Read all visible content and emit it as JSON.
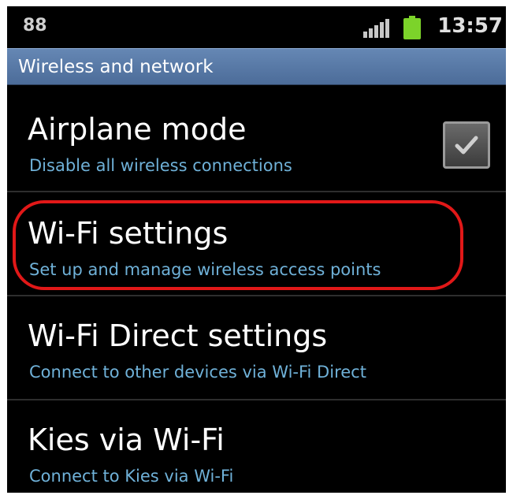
{
  "status_bar": {
    "left_indicator": "88",
    "time": "13:57",
    "signal_icon": "signal-bars-icon",
    "battery_icon": "battery-icon",
    "battery_color": "#7cd32a"
  },
  "section": {
    "title": "Wireless and network"
  },
  "items": [
    {
      "title": "Airplane mode",
      "subtitle": "Disable all wireless connections",
      "has_checkbox": true,
      "checked": true
    },
    {
      "title": "Wi-Fi settings",
      "subtitle": "Set up and manage wireless access points",
      "highlighted": true,
      "highlight_color": "#e11818"
    },
    {
      "title": "Wi-Fi Direct settings",
      "subtitle": "Connect to other devices via Wi-Fi Direct"
    },
    {
      "title": "Kies via Wi-Fi",
      "subtitle": "Connect to Kies via Wi-Fi"
    }
  ]
}
